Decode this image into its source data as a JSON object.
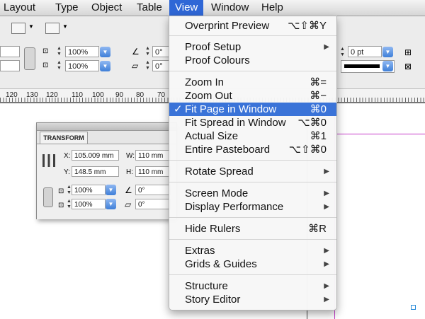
{
  "menubar": {
    "items": [
      "Layout",
      "Type",
      "Object",
      "Table",
      "View",
      "Window",
      "Help"
    ],
    "selected": "View"
  },
  "toolbar": {
    "scale_x": "100%",
    "scale_y": "100%",
    "rotate": "0°",
    "shear": "0°",
    "stroke_weight": "0 pt"
  },
  "ruler": {
    "labels": [
      "120",
      "130",
      "120",
      "110",
      "100",
      "90",
      "80",
      "70"
    ]
  },
  "transform_panel": {
    "title": "TRANSFORM",
    "x_label": "X:",
    "x_value": "105.009 mm",
    "y_label": "Y:",
    "y_value": "148.5 mm",
    "w_label": "W:",
    "w_value": "110 mm",
    "h_label": "H:",
    "h_value": "110 mm",
    "scale_x": "100%",
    "scale_y": "100%",
    "rotate": "0°",
    "shear": "0°"
  },
  "view_menu": {
    "items": [
      {
        "label": "Overprint Preview",
        "shortcut": "⌥⇧⌘Y"
      },
      {
        "label": "Proof Setup",
        "submenu": true
      },
      {
        "label": "Proof Colours"
      },
      {
        "label": "Zoom In",
        "shortcut": "⌘="
      },
      {
        "label": "Zoom Out",
        "shortcut": "⌘−"
      },
      {
        "label": "Fit Page in Window",
        "shortcut": "⌘0",
        "checked": true,
        "highlighted": true
      },
      {
        "label": "Fit Spread in Window",
        "shortcut": "⌥⌘0"
      },
      {
        "label": "Actual Size",
        "shortcut": "⌘1"
      },
      {
        "label": "Entire Pasteboard",
        "shortcut": "⌥⇧⌘0"
      },
      {
        "label": "Rotate Spread",
        "submenu": true
      },
      {
        "label": "Screen Mode",
        "submenu": true
      },
      {
        "label": "Display Performance",
        "submenu": true
      },
      {
        "label": "Hide Rulers",
        "shortcut": "⌘R"
      },
      {
        "label": "Extras",
        "submenu": true
      },
      {
        "label": "Grids & Guides",
        "submenu": true
      },
      {
        "label": "Structure",
        "submenu": true
      },
      {
        "label": "Story Editor",
        "submenu": true
      }
    ],
    "check_glyph": "✓",
    "submenu_glyph": "▶"
  },
  "colors": {
    "menu_highlight": "#3a73d8",
    "guide_magenta": "#c43ac9"
  }
}
